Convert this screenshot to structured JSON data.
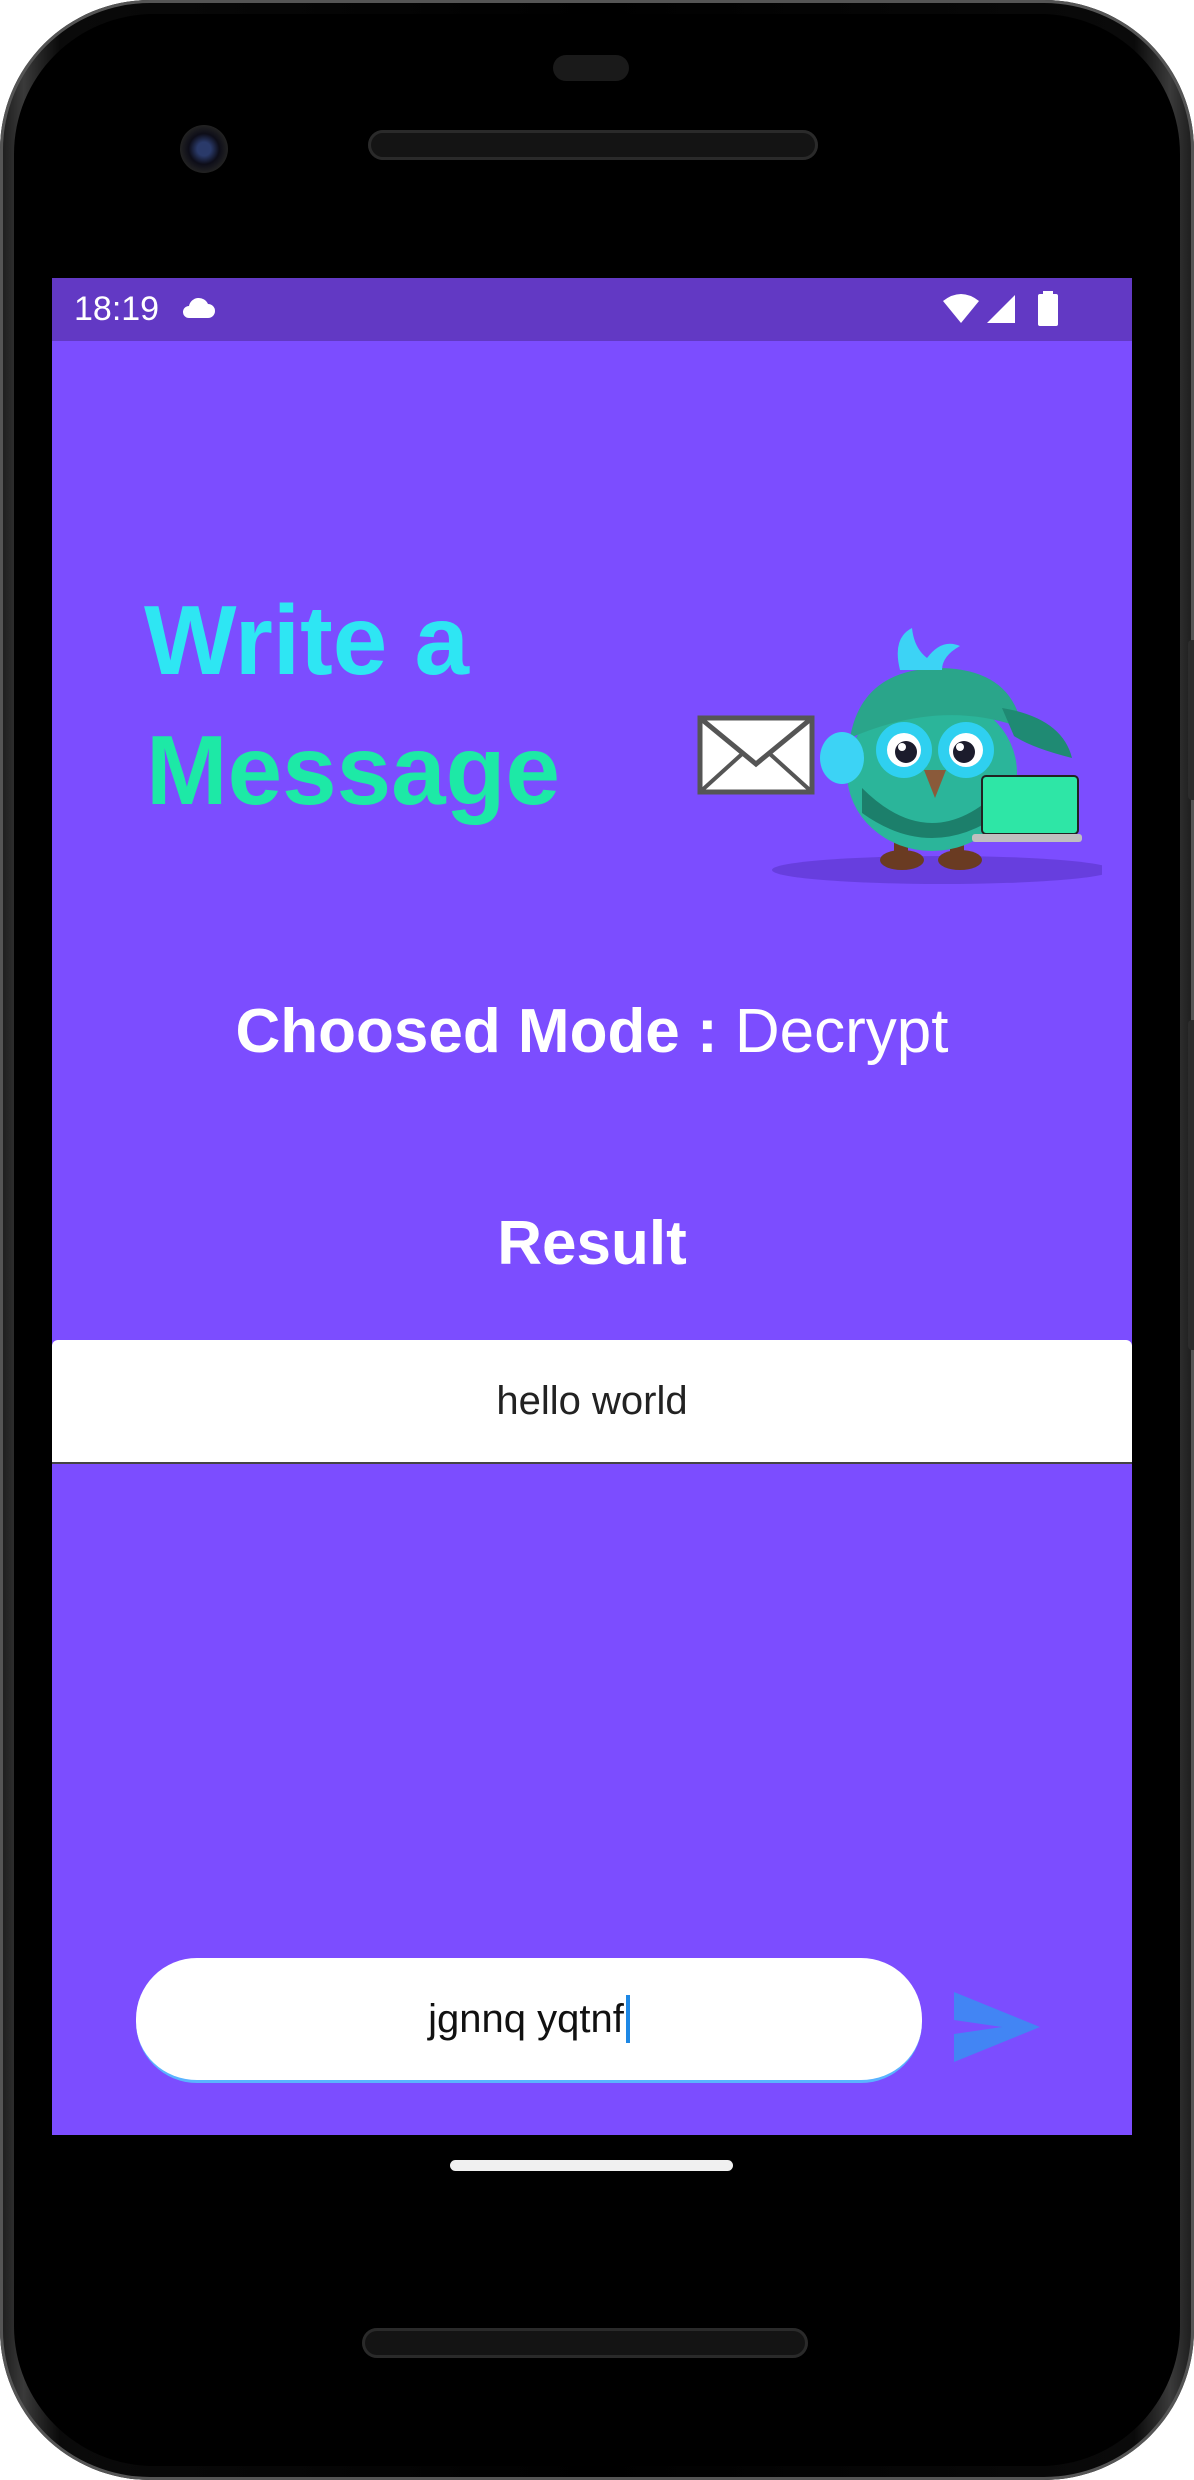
{
  "status_bar": {
    "time": "18:19",
    "icons": [
      "cloud-icon",
      "wifi-icon",
      "signal-icon",
      "battery-icon"
    ]
  },
  "header": {
    "title_line1": "Write a",
    "title_line2": "Message",
    "illustration": "owl-mascot-with-envelope-and-laptop"
  },
  "mode": {
    "label": "Choosed Mode :",
    "value": "Decrypt"
  },
  "result": {
    "heading": "Result",
    "text": "hello world"
  },
  "composer": {
    "input_value": "jgnnq yqtnf",
    "send_icon": "send-icon"
  },
  "colors": {
    "background": "#7c4dff",
    "status_bar": "#6239c4",
    "title_line1": "#2ee6f3",
    "title_line2": "#1de9a6",
    "send_button": "#4285f4"
  }
}
